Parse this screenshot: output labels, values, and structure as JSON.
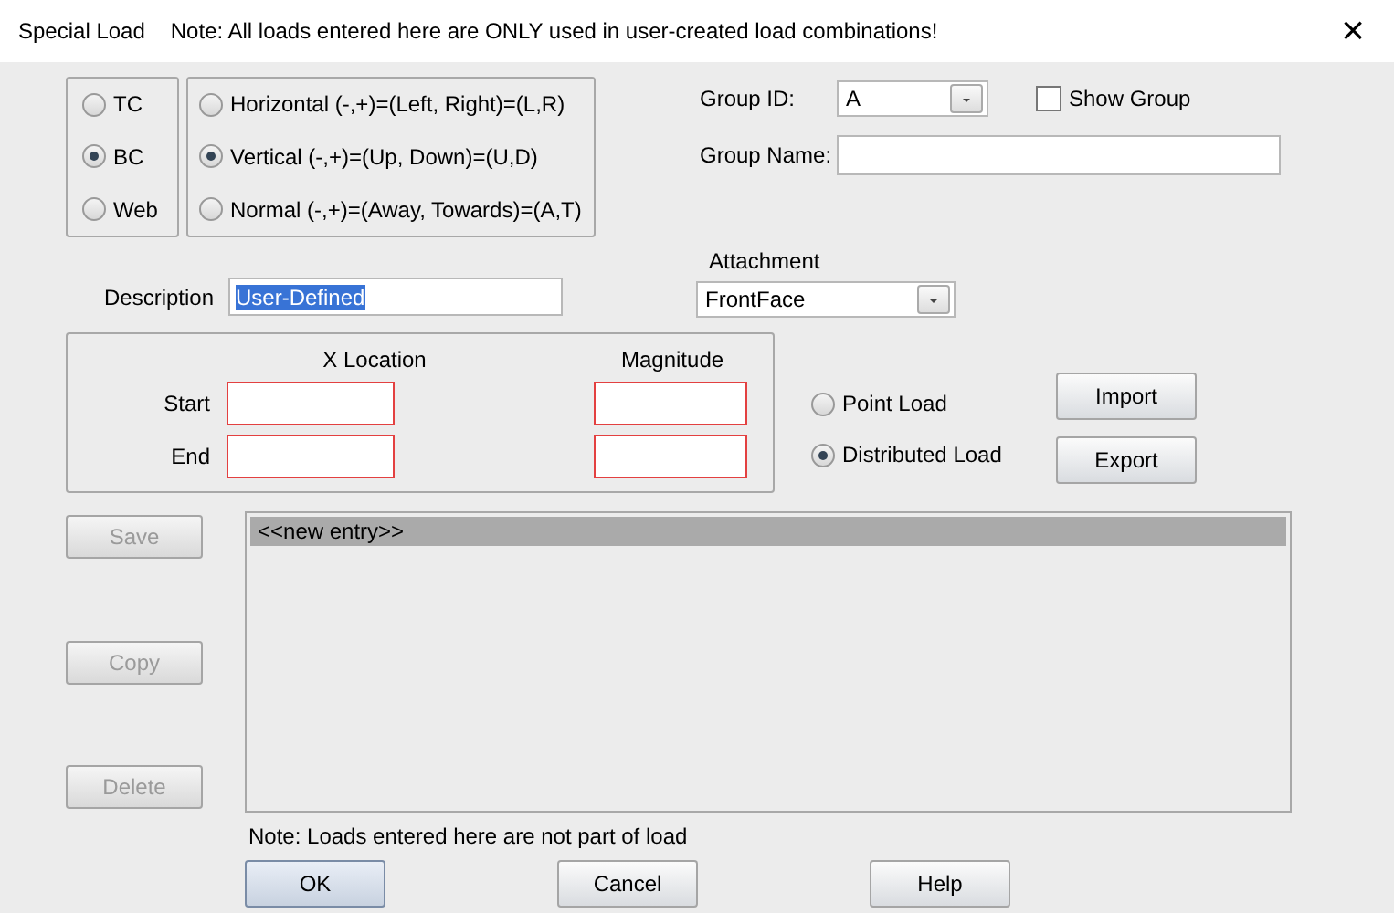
{
  "window": {
    "title": "Special Load",
    "note": "Note: All loads entered here are ONLY used in user-created load combinations!",
    "close": "×"
  },
  "members": [
    {
      "label": "TC",
      "selected": false
    },
    {
      "label": "BC",
      "selected": true
    },
    {
      "label": "Web",
      "selected": false
    }
  ],
  "directions": [
    {
      "label": "Horizontal (-,+)=(Left, Right)=(L,R)",
      "selected": false
    },
    {
      "label": "Vertical (-,+)=(Up, Down)=(U,D)",
      "selected": true
    },
    {
      "label": "Normal (-,+)=(Away, Towards)=(A,T)",
      "selected": false
    }
  ],
  "group": {
    "id_label": "Group ID:",
    "id_value": "A",
    "show_group": {
      "label": "Show Group",
      "checked": false
    },
    "name_label": "Group Name:"
  },
  "description": {
    "label": "Description",
    "value": "User-Defined"
  },
  "attachment": {
    "label": "Attachment",
    "value": "FrontFace"
  },
  "location": {
    "x_heading": "X Location",
    "magnitude_heading": "Magnitude",
    "rows": [
      {
        "label": "Start"
      },
      {
        "label": "End"
      }
    ]
  },
  "load_types": [
    {
      "label": "Point Load",
      "selected": false
    },
    {
      "label": "Distributed Load",
      "selected": true
    }
  ],
  "io_buttons": [
    "Import",
    "Export"
  ],
  "side_buttons": [
    {
      "label": "Save",
      "disabled": true
    },
    {
      "label": "Copy",
      "disabled": true
    },
    {
      "label": "Delete",
      "disabled": true
    }
  ],
  "entries": [
    {
      "label": "<<new entry>>",
      "selected": true
    }
  ],
  "footnote": "Note: Loads entered here are not part of load",
  "buttons": [
    {
      "label": "OK",
      "default": true
    },
    {
      "label": "Cancel",
      "default": false
    },
    {
      "label": "Help",
      "default": false
    }
  ]
}
